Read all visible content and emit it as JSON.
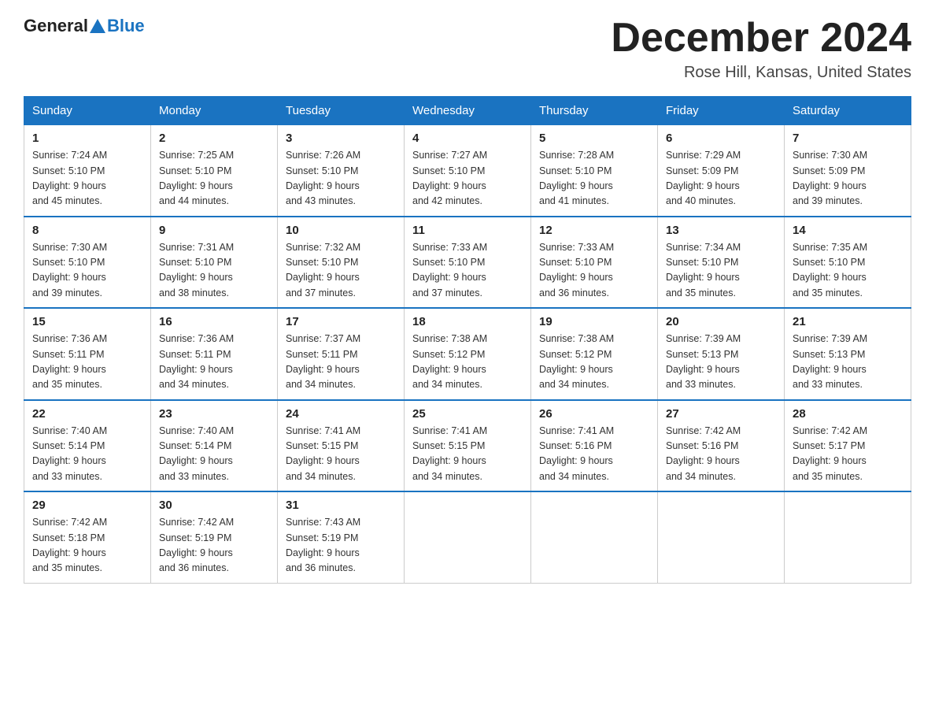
{
  "header": {
    "logo_general": "General",
    "logo_blue": "Blue",
    "title": "December 2024",
    "subtitle": "Rose Hill, Kansas, United States"
  },
  "days_of_week": [
    "Sunday",
    "Monday",
    "Tuesday",
    "Wednesday",
    "Thursday",
    "Friday",
    "Saturday"
  ],
  "weeks": [
    [
      {
        "day": "1",
        "sunrise": "7:24 AM",
        "sunset": "5:10 PM",
        "daylight": "9 hours and 45 minutes."
      },
      {
        "day": "2",
        "sunrise": "7:25 AM",
        "sunset": "5:10 PM",
        "daylight": "9 hours and 44 minutes."
      },
      {
        "day": "3",
        "sunrise": "7:26 AM",
        "sunset": "5:10 PM",
        "daylight": "9 hours and 43 minutes."
      },
      {
        "day": "4",
        "sunrise": "7:27 AM",
        "sunset": "5:10 PM",
        "daylight": "9 hours and 42 minutes."
      },
      {
        "day": "5",
        "sunrise": "7:28 AM",
        "sunset": "5:10 PM",
        "daylight": "9 hours and 41 minutes."
      },
      {
        "day": "6",
        "sunrise": "7:29 AM",
        "sunset": "5:09 PM",
        "daylight": "9 hours and 40 minutes."
      },
      {
        "day": "7",
        "sunrise": "7:30 AM",
        "sunset": "5:09 PM",
        "daylight": "9 hours and 39 minutes."
      }
    ],
    [
      {
        "day": "8",
        "sunrise": "7:30 AM",
        "sunset": "5:10 PM",
        "daylight": "9 hours and 39 minutes."
      },
      {
        "day": "9",
        "sunrise": "7:31 AM",
        "sunset": "5:10 PM",
        "daylight": "9 hours and 38 minutes."
      },
      {
        "day": "10",
        "sunrise": "7:32 AM",
        "sunset": "5:10 PM",
        "daylight": "9 hours and 37 minutes."
      },
      {
        "day": "11",
        "sunrise": "7:33 AM",
        "sunset": "5:10 PM",
        "daylight": "9 hours and 37 minutes."
      },
      {
        "day": "12",
        "sunrise": "7:33 AM",
        "sunset": "5:10 PM",
        "daylight": "9 hours and 36 minutes."
      },
      {
        "day": "13",
        "sunrise": "7:34 AM",
        "sunset": "5:10 PM",
        "daylight": "9 hours and 35 minutes."
      },
      {
        "day": "14",
        "sunrise": "7:35 AM",
        "sunset": "5:10 PM",
        "daylight": "9 hours and 35 minutes."
      }
    ],
    [
      {
        "day": "15",
        "sunrise": "7:36 AM",
        "sunset": "5:11 PM",
        "daylight": "9 hours and 35 minutes."
      },
      {
        "day": "16",
        "sunrise": "7:36 AM",
        "sunset": "5:11 PM",
        "daylight": "9 hours and 34 minutes."
      },
      {
        "day": "17",
        "sunrise": "7:37 AM",
        "sunset": "5:11 PM",
        "daylight": "9 hours and 34 minutes."
      },
      {
        "day": "18",
        "sunrise": "7:38 AM",
        "sunset": "5:12 PM",
        "daylight": "9 hours and 34 minutes."
      },
      {
        "day": "19",
        "sunrise": "7:38 AM",
        "sunset": "5:12 PM",
        "daylight": "9 hours and 34 minutes."
      },
      {
        "day": "20",
        "sunrise": "7:39 AM",
        "sunset": "5:13 PM",
        "daylight": "9 hours and 33 minutes."
      },
      {
        "day": "21",
        "sunrise": "7:39 AM",
        "sunset": "5:13 PM",
        "daylight": "9 hours and 33 minutes."
      }
    ],
    [
      {
        "day": "22",
        "sunrise": "7:40 AM",
        "sunset": "5:14 PM",
        "daylight": "9 hours and 33 minutes."
      },
      {
        "day": "23",
        "sunrise": "7:40 AM",
        "sunset": "5:14 PM",
        "daylight": "9 hours and 33 minutes."
      },
      {
        "day": "24",
        "sunrise": "7:41 AM",
        "sunset": "5:15 PM",
        "daylight": "9 hours and 34 minutes."
      },
      {
        "day": "25",
        "sunrise": "7:41 AM",
        "sunset": "5:15 PM",
        "daylight": "9 hours and 34 minutes."
      },
      {
        "day": "26",
        "sunrise": "7:41 AM",
        "sunset": "5:16 PM",
        "daylight": "9 hours and 34 minutes."
      },
      {
        "day": "27",
        "sunrise": "7:42 AM",
        "sunset": "5:16 PM",
        "daylight": "9 hours and 34 minutes."
      },
      {
        "day": "28",
        "sunrise": "7:42 AM",
        "sunset": "5:17 PM",
        "daylight": "9 hours and 35 minutes."
      }
    ],
    [
      {
        "day": "29",
        "sunrise": "7:42 AM",
        "sunset": "5:18 PM",
        "daylight": "9 hours and 35 minutes."
      },
      {
        "day": "30",
        "sunrise": "7:42 AM",
        "sunset": "5:19 PM",
        "daylight": "9 hours and 36 minutes."
      },
      {
        "day": "31",
        "sunrise": "7:43 AM",
        "sunset": "5:19 PM",
        "daylight": "9 hours and 36 minutes."
      },
      null,
      null,
      null,
      null
    ]
  ]
}
